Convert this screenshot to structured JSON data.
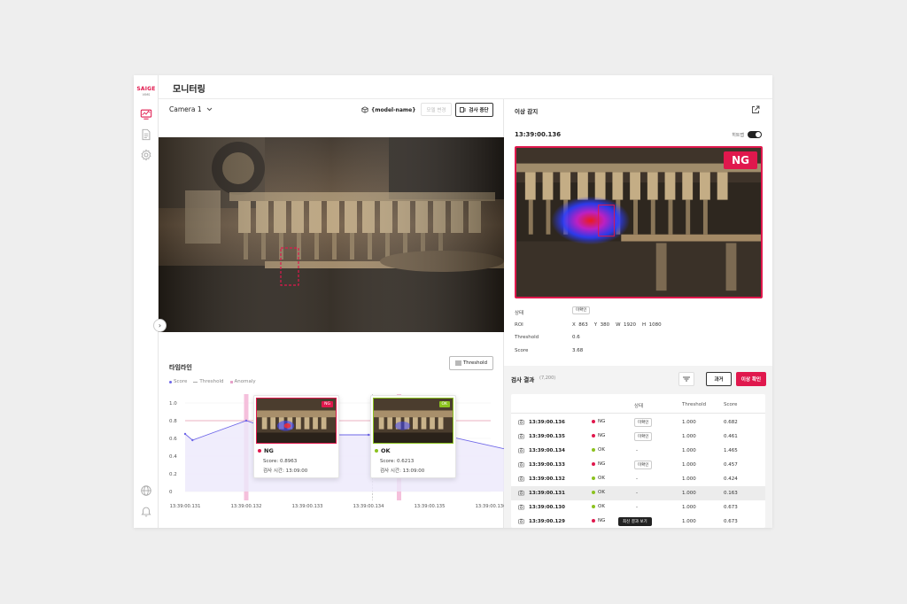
{
  "brand": {
    "name": "SAIGE",
    "sub": "VIMS"
  },
  "sidebar": {
    "icons": [
      "monitor-icon",
      "document-icon",
      "gear-icon",
      "globe-icon",
      "bell-icon"
    ]
  },
  "header": {
    "title": "모니터링"
  },
  "left": {
    "camera": "Camera 1",
    "model_name": "{model-name}",
    "model_change_label": "모델 변경",
    "stop_label": "검사 중단",
    "timeline_title": "타임라인",
    "threshold_btn": "Threshold",
    "legend": {
      "score": "Score",
      "threshold": "Threshold",
      "anomaly": "Anomaly"
    }
  },
  "chart_data": {
    "type": "line",
    "x": [
      "13:39:00.131",
      "13:39:00.132",
      "13:39:00.133",
      "13:39:00.134",
      "13:39:00.135",
      "13:39:00.136"
    ],
    "y_ticks": [
      "1.0",
      "0.8",
      "0.6",
      "0.4",
      "0.2",
      "0"
    ],
    "ylim": [
      0,
      1.0
    ],
    "threshold": 0.8,
    "series": [
      {
        "name": "Score",
        "points": [
          [
            0,
            0.65
          ],
          [
            0.12,
            0.58
          ],
          [
            1.0,
            0.8
          ],
          [
            1.7,
            0.64
          ],
          [
            3.0,
            0.64
          ],
          [
            4.2,
            0.64
          ],
          [
            5.3,
            0.47
          ]
        ]
      }
    ],
    "anomaly_markers": [
      1.0,
      3.5
    ]
  },
  "popups": {
    "ng": {
      "tag": "NG",
      "title": "NG",
      "score": "Score: 0.8963",
      "time": "검사 시간: 13:09:00"
    },
    "ok": {
      "tag": "OK",
      "title": "OK",
      "score": "Score: 0.6213",
      "time": "검사 시간: 13:09:00"
    }
  },
  "right": {
    "title": "이상 감지",
    "timestamp": "13:39:00.136",
    "heatmap_label": "히트맵",
    "badge": "NG",
    "info": {
      "status_label": "상태",
      "status_value": "미확인",
      "roi_label": "ROI",
      "roi_value": "X  863    Y  380    W  1920    H  1080",
      "threshold_label": "Threshold",
      "threshold_value": "0.6",
      "score_label": "Score",
      "score_value": "3.68"
    },
    "results": {
      "title": "검사 결과",
      "count": "(7,200)",
      "past_btn": "과거",
      "check_btn": "이상 확인",
      "columns": {
        "status": "상태",
        "threshold": "Threshold",
        "score": "Score"
      },
      "rows": [
        {
          "time": "13:39:00.136",
          "result": "NG",
          "status": "미확인",
          "threshold": "1.000",
          "score": "0.682"
        },
        {
          "time": "13:39:00.135",
          "result": "NG",
          "status": "미확인",
          "threshold": "1.000",
          "score": "0.461"
        },
        {
          "time": "13:39:00.134",
          "result": "OK",
          "status": "-",
          "threshold": "1.000",
          "score": "1.465"
        },
        {
          "time": "13:39:00.133",
          "result": "NG",
          "status": "미확인",
          "threshold": "1.000",
          "score": "0.457"
        },
        {
          "time": "13:39:00.132",
          "result": "OK",
          "status": "-",
          "threshold": "1.000",
          "score": "0.424"
        },
        {
          "time": "13:39:00.131",
          "result": "OK",
          "status": "-",
          "threshold": "1.000",
          "score": "0.163"
        },
        {
          "time": "13:39:00.130",
          "result": "OK",
          "status": "-",
          "threshold": "1.000",
          "score": "0.673"
        },
        {
          "time": "13:39:00.129",
          "result": "NG",
          "status": "",
          "threshold": "1.000",
          "score": "0.673"
        }
      ],
      "tooltip": "최신 결과 보기"
    }
  },
  "colors": {
    "accent": "#e0184d",
    "ok": "#8cc21f",
    "score_line": "#6e66e8"
  }
}
